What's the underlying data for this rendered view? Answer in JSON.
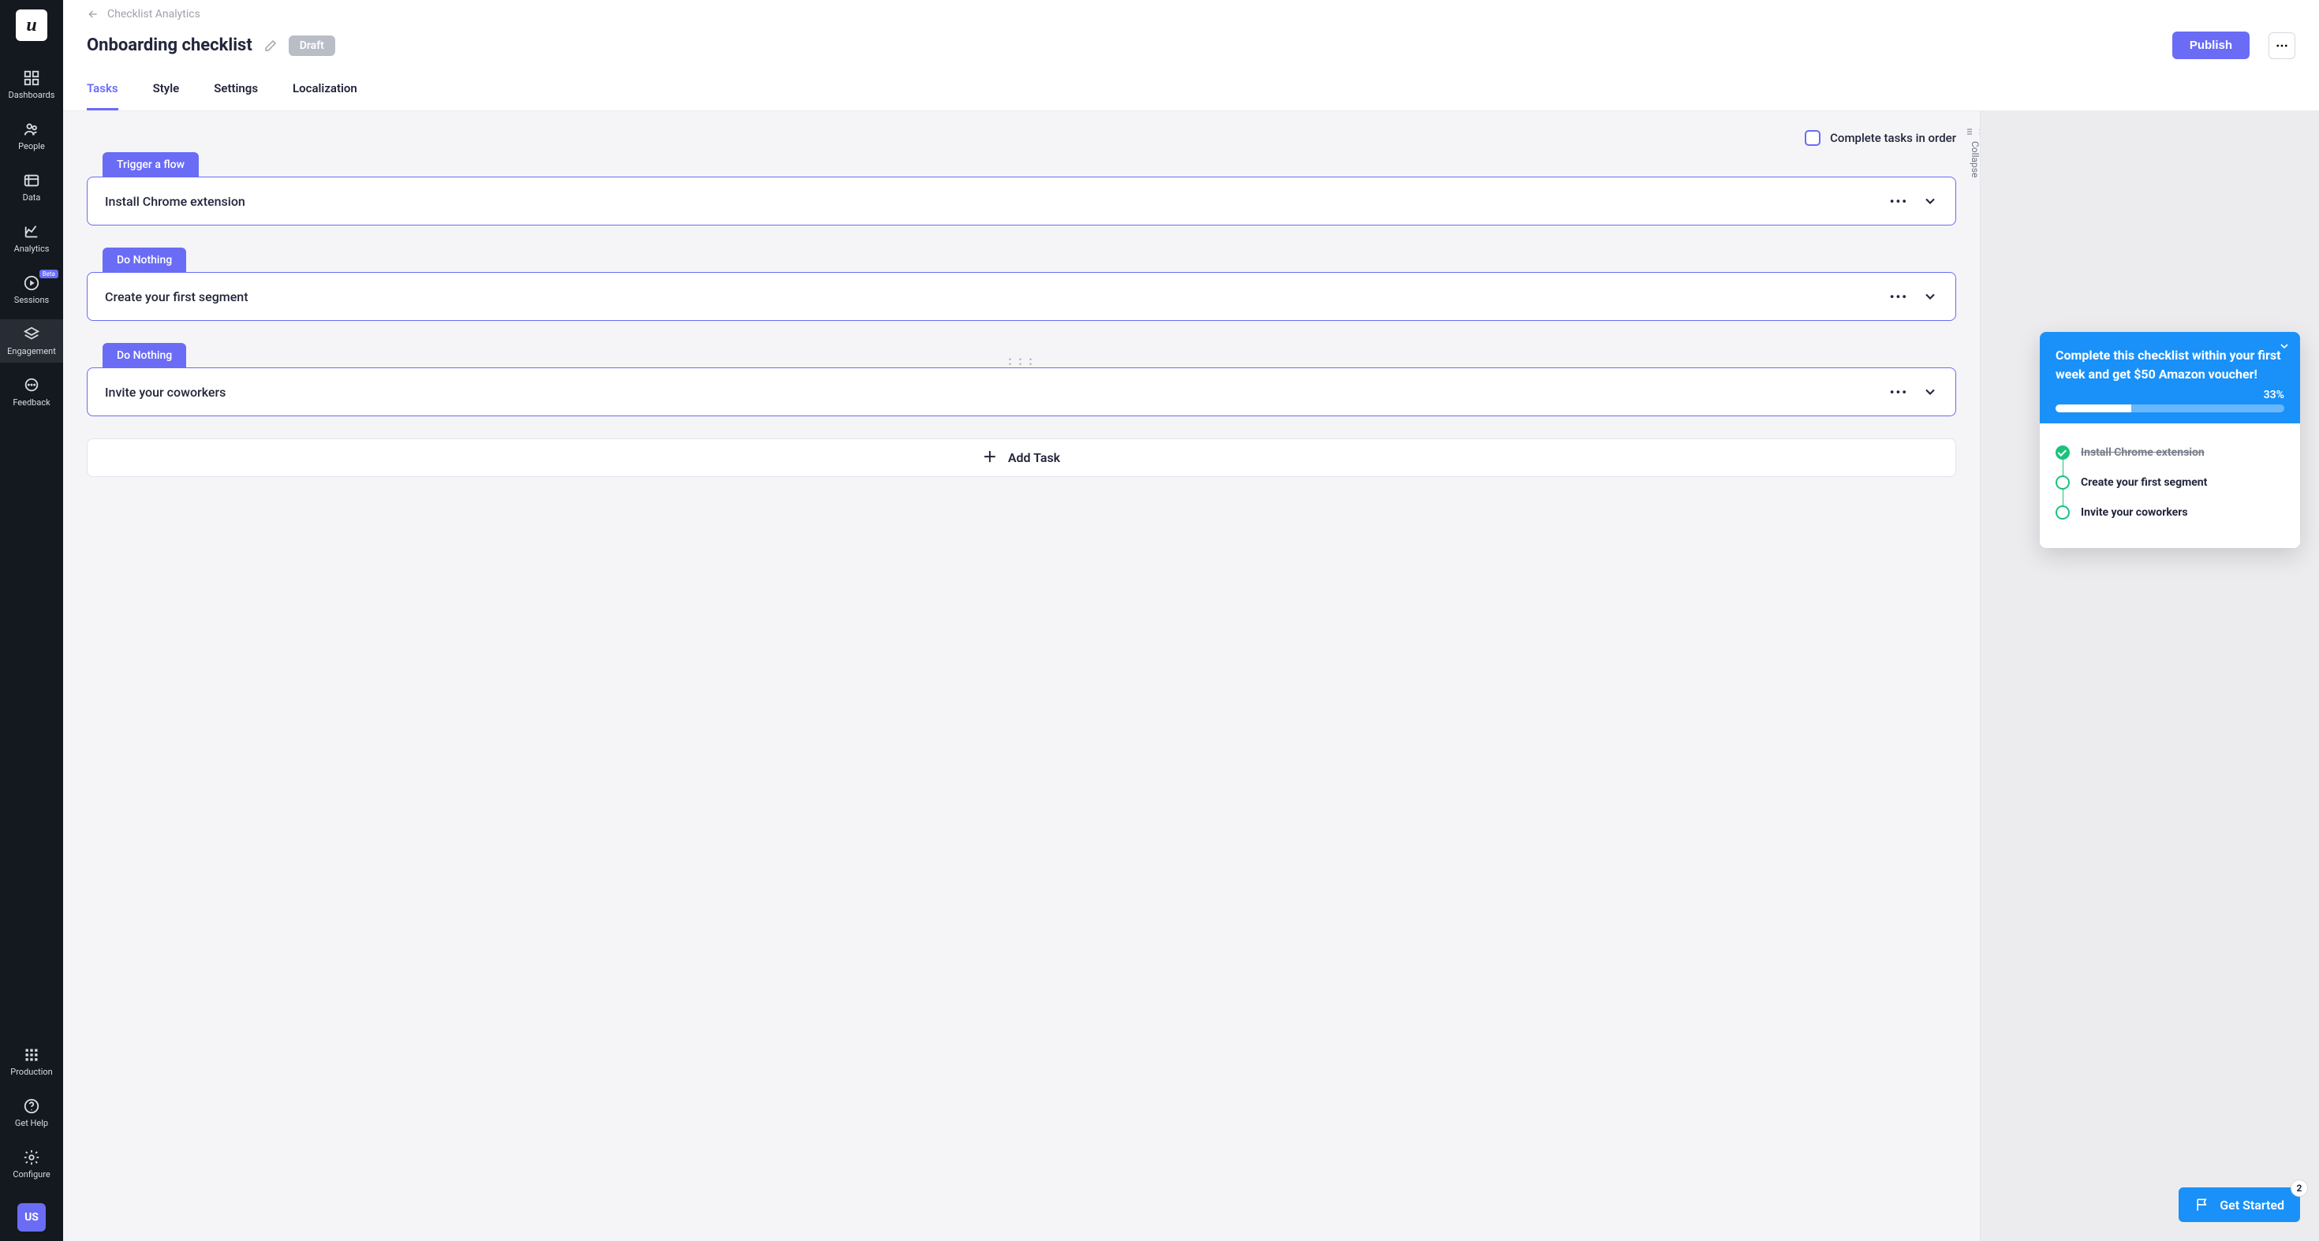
{
  "app": {
    "logo_letter": "u",
    "user_initials": "US"
  },
  "sidebar": {
    "items": [
      {
        "label": "Dashboards"
      },
      {
        "label": "People"
      },
      {
        "label": "Data"
      },
      {
        "label": "Analytics"
      },
      {
        "label": "Sessions",
        "beta": "Beta"
      },
      {
        "label": "Engagement",
        "active": true
      },
      {
        "label": "Feedback"
      }
    ],
    "bottom": [
      {
        "label": "Production"
      },
      {
        "label": "Get Help"
      },
      {
        "label": "Configure"
      }
    ]
  },
  "header": {
    "breadcrumb": "Checklist Analytics",
    "title": "Onboarding checklist",
    "status": "Draft",
    "publish": "Publish",
    "tabs": [
      {
        "label": "Tasks",
        "active": true
      },
      {
        "label": "Style"
      },
      {
        "label": "Settings"
      },
      {
        "label": "Localization"
      }
    ]
  },
  "tasks": {
    "complete_in_order": "Complete tasks in order",
    "collapse_label": "Collapse",
    "add_label": "Add Task",
    "items": [
      {
        "tag": "Trigger a flow",
        "title": "Install Chrome extension"
      },
      {
        "tag": "Do Nothing",
        "title": "Create your first segment"
      },
      {
        "tag": "Do Nothing",
        "title": "Invite your coworkers",
        "drag": true
      }
    ]
  },
  "preview": {
    "headline": "Complete this checklist within your first week and get $50 Amazon voucher!",
    "percent": "33%",
    "percent_value": 33,
    "items": [
      {
        "label": "Install Chrome extension",
        "done": true
      },
      {
        "label": "Create your first segment",
        "done": false
      },
      {
        "label": "Invite your coworkers",
        "done": false
      }
    ],
    "cta": "Get Started",
    "cta_count": "2"
  }
}
